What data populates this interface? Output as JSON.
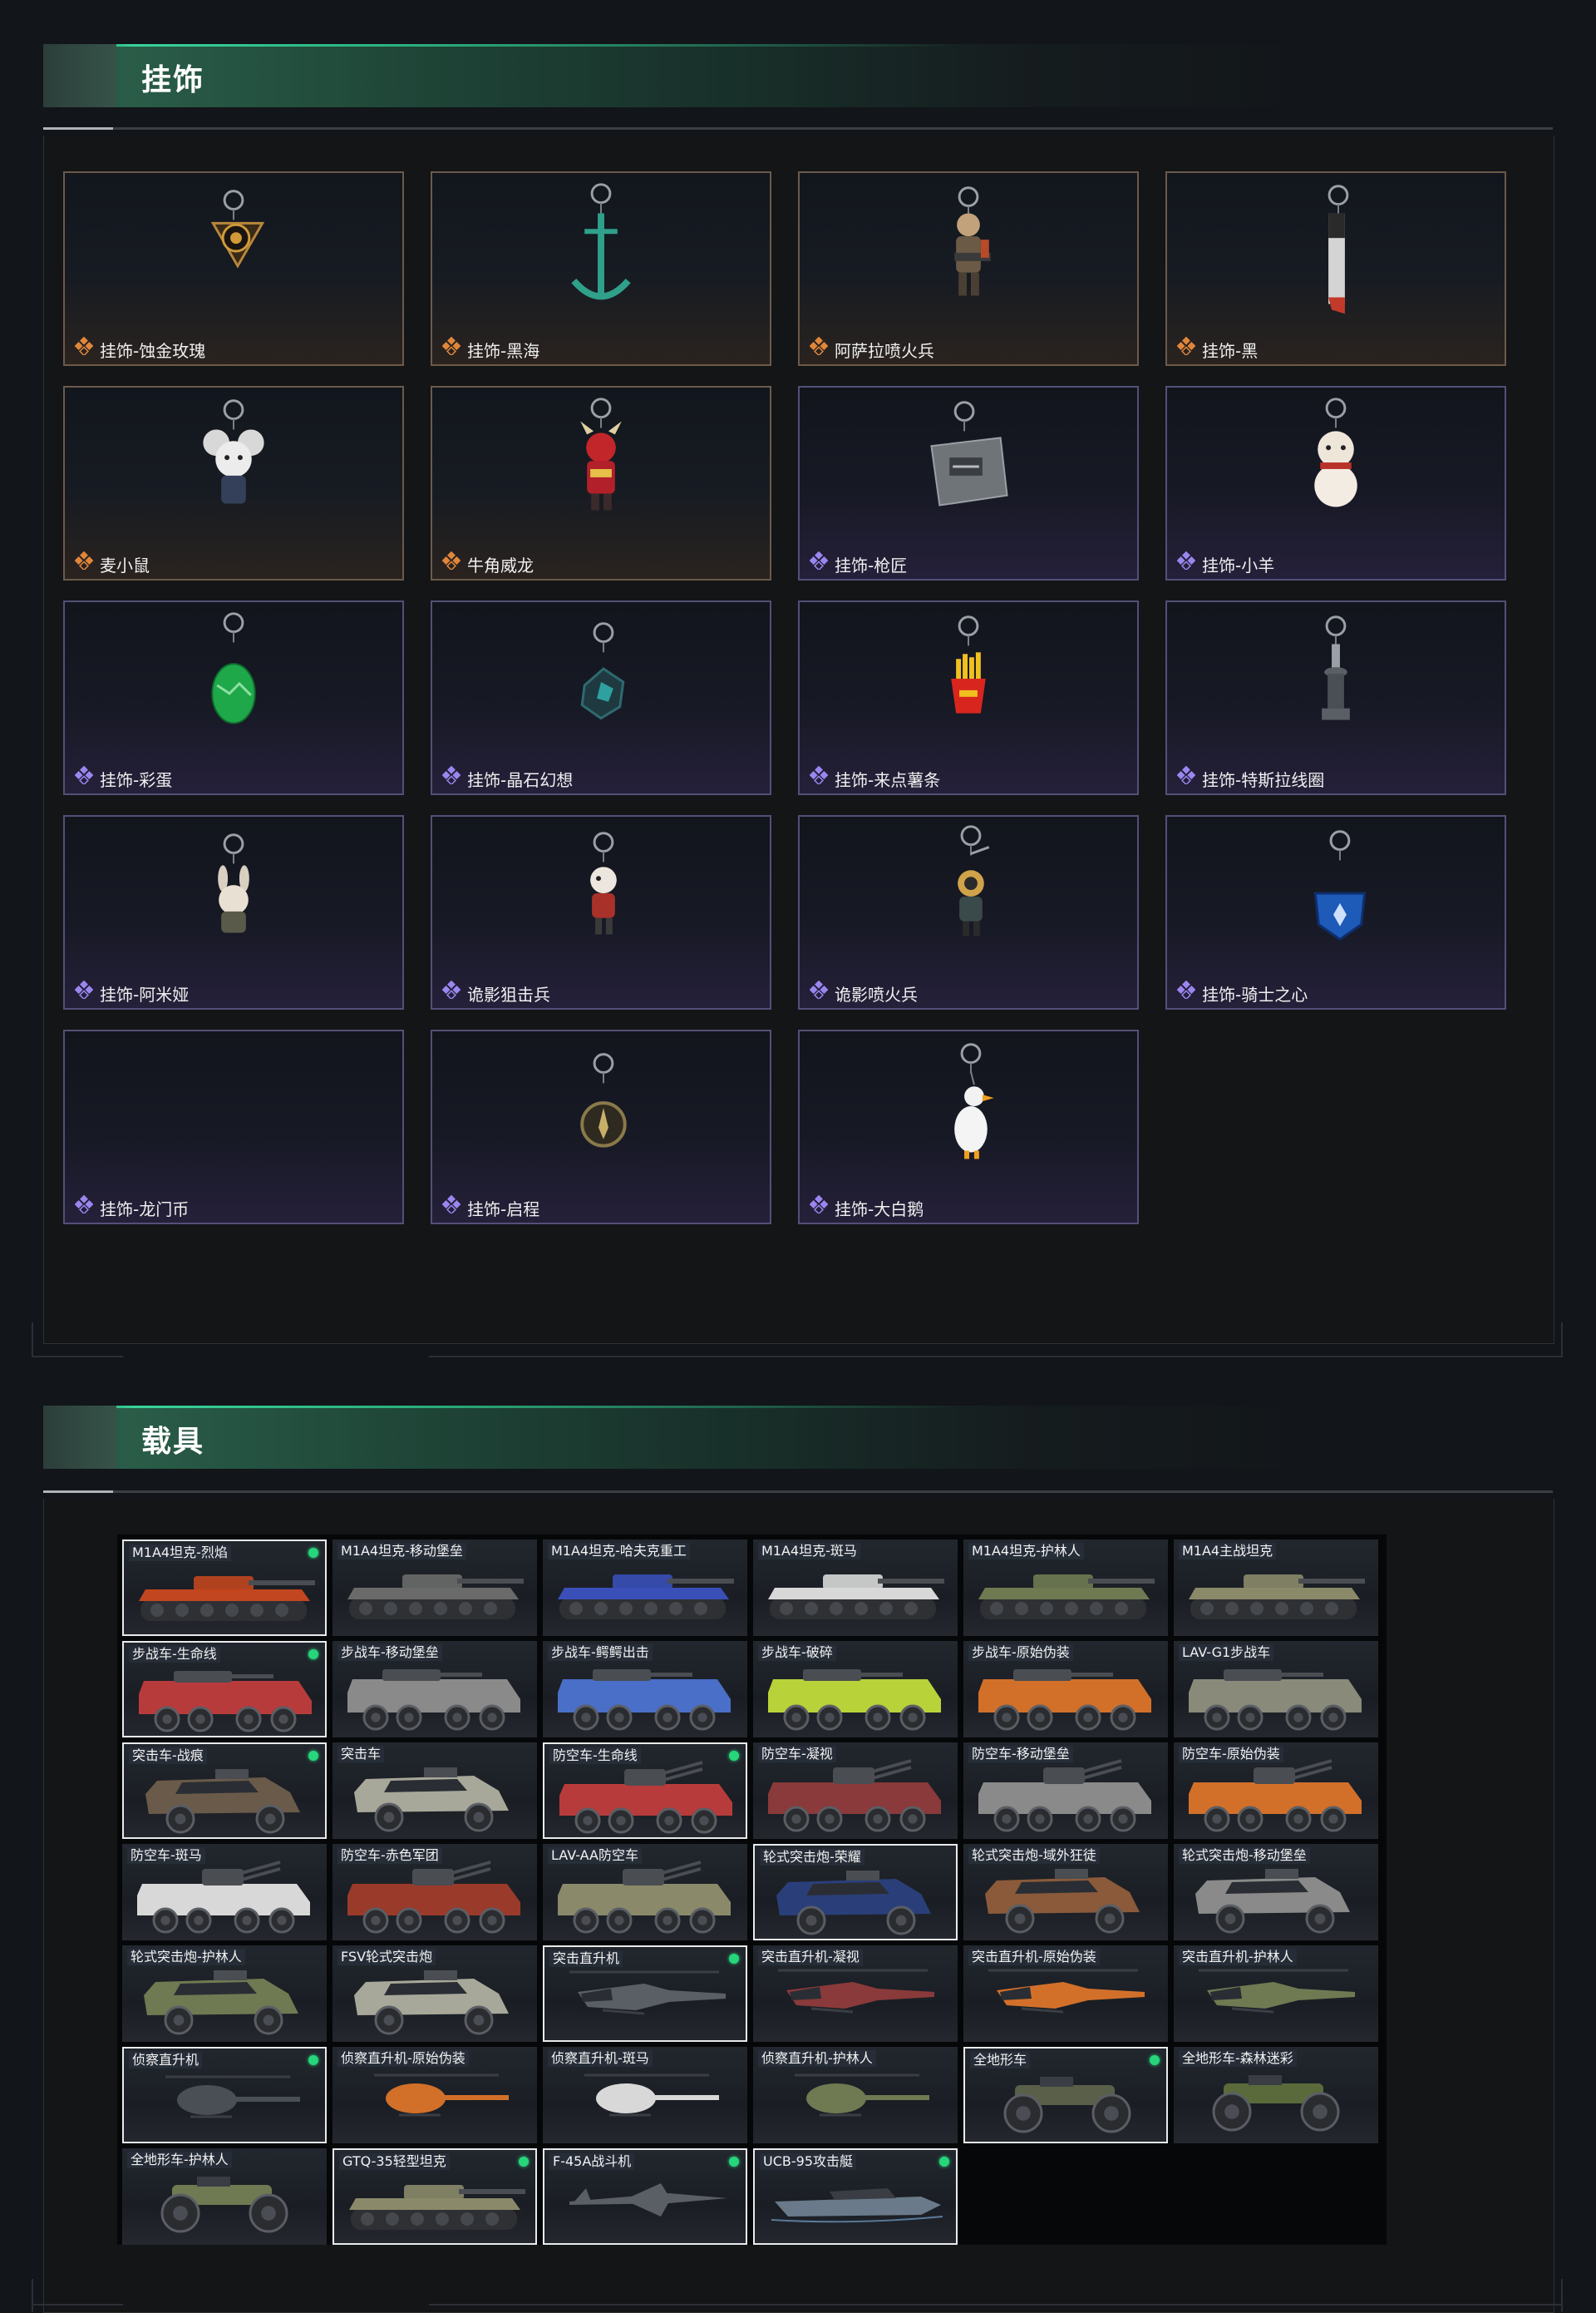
{
  "sections": {
    "charms_title": "挂饰",
    "vehicles_title": "载具"
  },
  "colors": {
    "gold_rarity": "#e0863a",
    "purple_rarity": "#9b86f0",
    "accent_green": "#2ab07e",
    "owned_dot": "#27d57b"
  },
  "charms": [
    {
      "label": "挂饰-蚀金玫瑰",
      "rarity": "gold",
      "icon": "rose-medallion-charm"
    },
    {
      "label": "挂饰-黑海",
      "rarity": "gold",
      "icon": "anchor-charm"
    },
    {
      "label": "阿萨拉喷火兵",
      "rarity": "gold",
      "icon": "flamethrower-soldier-charm"
    },
    {
      "label": "挂饰-黑",
      "rarity": "gold",
      "icon": "knife-charm"
    },
    {
      "label": "麦小鼠",
      "rarity": "gold",
      "icon": "mouse-charm"
    },
    {
      "label": "牛角威龙",
      "rarity": "gold",
      "icon": "horned-dragon-charm"
    },
    {
      "label": "挂饰-枪匠",
      "rarity": "purple",
      "icon": "gunsmith-box-charm"
    },
    {
      "label": "挂饰-小羊",
      "rarity": "purple",
      "icon": "lamb-charm"
    },
    {
      "label": "挂饰-彩蛋",
      "rarity": "purple",
      "icon": "green-egg-charm"
    },
    {
      "label": "挂饰-晶石幻想",
      "rarity": "purple",
      "icon": "crystal-cube-charm"
    },
    {
      "label": "挂饰-来点薯条",
      "rarity": "purple",
      "icon": "fries-charm"
    },
    {
      "label": "挂饰-特斯拉线圈",
      "rarity": "purple",
      "icon": "tesla-coil-charm"
    },
    {
      "label": "挂饰-阿米娅",
      "rarity": "purple",
      "icon": "bunny-charm"
    },
    {
      "label": "诡影狙击兵",
      "rarity": "purple",
      "icon": "sniper-figure-charm"
    },
    {
      "label": "诡影喷火兵",
      "rarity": "purple",
      "icon": "flamer-figure-charm"
    },
    {
      "label": "挂饰-骑士之心",
      "rarity": "purple",
      "icon": "knight-heart-charm"
    },
    {
      "label": "挂饰-龙门币",
      "rarity": "purple",
      "icon": "none"
    },
    {
      "label": "挂饰-启程",
      "rarity": "purple",
      "icon": "compass-coin-charm"
    },
    {
      "label": "挂饰-大白鹅",
      "rarity": "purple",
      "icon": "goose-charm"
    }
  ],
  "vehicles": [
    {
      "label": "M1A4坦克-烈焰",
      "type": "tank",
      "selected": true,
      "owned": true,
      "tint": "#c2461f"
    },
    {
      "label": "M1A4坦克-移动堡垒",
      "type": "tank",
      "selected": false,
      "owned": false,
      "tint": "#6a6a6a"
    },
    {
      "label": "M1A4坦克-哈夫克重工",
      "type": "tank",
      "selected": false,
      "owned": false,
      "tint": "#3a4fb8"
    },
    {
      "label": "M1A4坦克-斑马",
      "type": "tank",
      "selected": false,
      "owned": false,
      "tint": "#d8d8d8"
    },
    {
      "label": "M1A4坦克-护林人",
      "type": "tank",
      "selected": false,
      "owned": false,
      "tint": "#6f7a52"
    },
    {
      "label": "M1A4主战坦克",
      "type": "tank",
      "selected": false,
      "owned": false,
      "tint": "#8a8a6a"
    },
    {
      "label": "步战车-生命线",
      "type": "ifv",
      "selected": true,
      "owned": true,
      "tint": "#b83b3b"
    },
    {
      "label": "步战车-移动堡垒",
      "type": "ifv",
      "selected": false,
      "owned": false,
      "tint": "#8a8a8a"
    },
    {
      "label": "步战车-鳄鳄出击",
      "type": "ifv",
      "selected": false,
      "owned": false,
      "tint": "#4a6fc8"
    },
    {
      "label": "步战车-破碎",
      "type": "ifv",
      "selected": false,
      "owned": false,
      "tint": "#b8d23a"
    },
    {
      "label": "步战车-原始伪装",
      "type": "ifv",
      "selected": false,
      "owned": false,
      "tint": "#d2702a"
    },
    {
      "label": "LAV-G1步战车",
      "type": "ifv",
      "selected": false,
      "owned": false,
      "tint": "#8a8a7a"
    },
    {
      "label": "突击车-战痕",
      "type": "car",
      "selected": true,
      "owned": true,
      "tint": "#6a5a4a"
    },
    {
      "label": "突击车",
      "type": "car",
      "selected": false,
      "owned": false,
      "tint": "#a8a89a"
    },
    {
      "label": "防空车-生命线",
      "type": "aa",
      "selected": true,
      "owned": true,
      "tint": "#b83b3b"
    },
    {
      "label": "防空车-凝视",
      "type": "aa",
      "selected": false,
      "owned": false,
      "tint": "#8a3a3a"
    },
    {
      "label": "防空车-移动堡垒",
      "type": "aa",
      "selected": false,
      "owned": false,
      "tint": "#8a8a8a"
    },
    {
      "label": "防空车-原始伪装",
      "type": "aa",
      "selected": false,
      "owned": false,
      "tint": "#d2702a"
    },
    {
      "label": "防空车-斑马",
      "type": "aa",
      "selected": false,
      "owned": false,
      "tint": "#d8d8d8"
    },
    {
      "label": "防空车-赤色军团",
      "type": "aa",
      "selected": false,
      "owned": false,
      "tint": "#9a3a2a"
    },
    {
      "label": "LAV-AA防空车",
      "type": "aa",
      "selected": false,
      "owned": false,
      "tint": "#8a8a6a"
    },
    {
      "label": "轮式突击炮-荣耀",
      "type": "car",
      "selected": true,
      "owned": false,
      "tint": "#2a3f7a"
    },
    {
      "label": "轮式突击炮-域外狂徒",
      "type": "car",
      "selected": false,
      "owned": false,
      "tint": "#8a5a3a"
    },
    {
      "label": "轮式突击炮-移动堡垒",
      "type": "car",
      "selected": false,
      "owned": false,
      "tint": "#8a8a8a"
    },
    {
      "label": "轮式突击炮-护林人",
      "type": "car",
      "selected": false,
      "owned": false,
      "tint": "#6f7a52"
    },
    {
      "label": "FSV轮式突击炮",
      "type": "car",
      "selected": false,
      "owned": false,
      "tint": "#a8a89a"
    },
    {
      "label": "突击直升机",
      "type": "heli",
      "selected": true,
      "owned": true,
      "tint": "#5a5f66"
    },
    {
      "label": "突击直升机-凝视",
      "type": "heli",
      "selected": false,
      "owned": false,
      "tint": "#8a3a3a"
    },
    {
      "label": "突击直升机-原始伪装",
      "type": "heli",
      "selected": false,
      "owned": false,
      "tint": "#d2702a"
    },
    {
      "label": "突击直升机-护林人",
      "type": "heli",
      "selected": false,
      "owned": false,
      "tint": "#6f7a52"
    },
    {
      "label": "侦察直升机",
      "type": "scout",
      "selected": true,
      "owned": true,
      "tint": "#4a4f56"
    },
    {
      "label": "侦察直升机-原始伪装",
      "type": "scout",
      "selected": false,
      "owned": false,
      "tint": "#d2702a"
    },
    {
      "label": "侦察直升机-斑马",
      "type": "scout",
      "selected": false,
      "owned": false,
      "tint": "#d8d8d8"
    },
    {
      "label": "侦察直升机-护林人",
      "type": "scout",
      "selected": false,
      "owned": false,
      "tint": "#6f7a52"
    },
    {
      "label": "全地形车",
      "type": "atv",
      "selected": true,
      "owned": true,
      "tint": "#5a5f4a"
    },
    {
      "label": "全地形车-森林迷彩",
      "type": "atv",
      "selected": false,
      "owned": false,
      "tint": "#5a6a3a"
    },
    {
      "label": "全地形车-护林人",
      "type": "atv",
      "selected": false,
      "owned": false,
      "tint": "#6f7a52"
    },
    {
      "label": "GTQ-35轻型坦克",
      "type": "tank",
      "selected": true,
      "owned": true,
      "tint": "#8a8a6a"
    },
    {
      "label": "F-45A战斗机",
      "type": "jet",
      "selected": true,
      "owned": true,
      "tint": "#5a5f66"
    },
    {
      "label": "UCB-95攻击艇",
      "type": "boat",
      "selected": true,
      "owned": true,
      "tint": "#6a7a8a"
    }
  ]
}
